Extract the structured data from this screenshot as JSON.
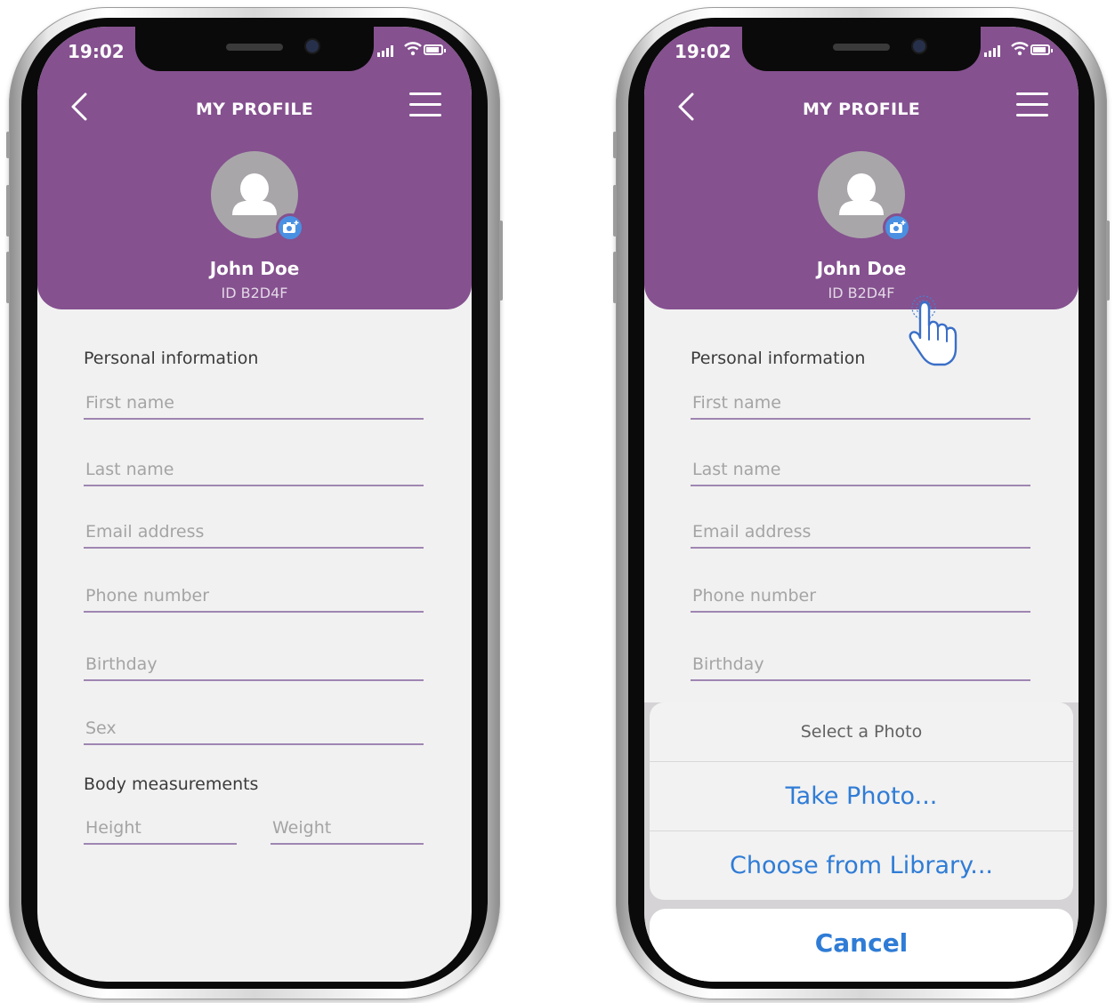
{
  "status": {
    "time": "19:02"
  },
  "header": {
    "title": "MY PROFILE"
  },
  "profile": {
    "name": "John Doe",
    "id_label": "ID  B2D4F"
  },
  "personal_information": {
    "label": "Personal information",
    "fields": {
      "first_name": "First name",
      "last_name": "Last name",
      "email": "Email address",
      "phone": "Phone number",
      "birthday": "Birthday",
      "sex": "Sex"
    }
  },
  "body_measurements": {
    "label": "Body measurements",
    "fields": {
      "height": "Height",
      "weight": "Weight"
    }
  },
  "photo_sheet": {
    "title": "Select a Photo",
    "take_photo": "Take Photo...",
    "choose_library": "Choose from Library...",
    "cancel": "Cancel"
  },
  "colors": {
    "header_purple": "#85518f",
    "field_underline": "#9f86b2",
    "action_blue": "#2f7cd6",
    "camera_badge": "#4a90e2"
  },
  "icons": [
    "back-chevron-icon",
    "hamburger-menu-icon",
    "person-icon",
    "camera-add-icon",
    "signal-icon",
    "wifi-icon",
    "battery-icon",
    "tap-hand-cursor-icon"
  ]
}
